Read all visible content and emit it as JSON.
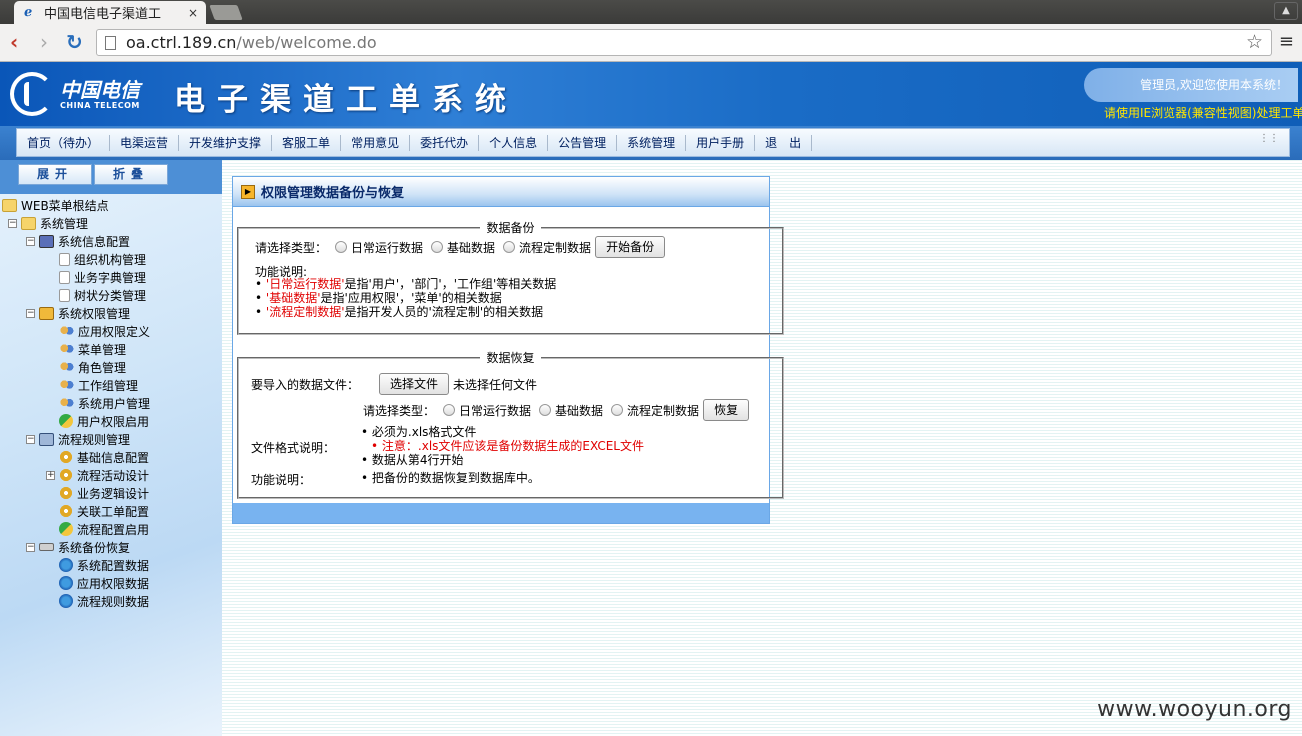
{
  "browser": {
    "tab_title": "中国电信电子渠道工",
    "tab_close": "×",
    "url_host": "oa.ctrl.189.cn",
    "url_path": "/web/welcome.do",
    "nav_back": "‹",
    "nav_forward": "›",
    "nav_reload": "↻",
    "star": "☆",
    "menu": "≡"
  },
  "header": {
    "logo_cn": "中国电信",
    "logo_en": "CHINA TELECOM",
    "system_title": "电子渠道工单系统",
    "welcome": "管理员,欢迎您使用本系统！",
    "ie_note": "请使用IE浏览器(兼容性视图)处理工单"
  },
  "nav": {
    "items": [
      "首页（待办）",
      "电渠运营",
      "开发维护支撑",
      "客服工单",
      "常用意见",
      "委托代办",
      "个人信息",
      "公告管理",
      "系统管理",
      "用户手册",
      "退　出"
    ]
  },
  "left": {
    "expand": "展开",
    "collapse": "折叠",
    "tree": [
      {
        "label": "WEB菜单根结点",
        "level": 0,
        "icon": "folder-icon",
        "toggle": ""
      },
      {
        "label": "系统管理",
        "level": 1,
        "icon": "folder-icon",
        "toggle": "−"
      },
      {
        "label": "系统信息配置",
        "level": 2,
        "icon": "book-icon",
        "toggle": "−"
      },
      {
        "label": "组织机构管理",
        "level": 3,
        "icon": "document-icon",
        "toggle": ""
      },
      {
        "label": "业务字典管理",
        "level": 3,
        "icon": "document-icon",
        "toggle": ""
      },
      {
        "label": "树状分类管理",
        "level": 3,
        "icon": "document-icon",
        "toggle": ""
      },
      {
        "label": "系统权限管理",
        "level": 2,
        "icon": "lock-icon",
        "toggle": "−"
      },
      {
        "label": "应用权限定义",
        "level": 3,
        "icon": "users-icon",
        "toggle": ""
      },
      {
        "label": "菜单管理",
        "level": 3,
        "icon": "users-icon",
        "toggle": ""
      },
      {
        "label": "角色管理",
        "level": 3,
        "icon": "users-icon",
        "toggle": ""
      },
      {
        "label": "工作组管理",
        "level": 3,
        "icon": "users-icon",
        "toggle": ""
      },
      {
        "label": "系统用户管理",
        "level": 3,
        "icon": "users-icon",
        "toggle": ""
      },
      {
        "label": "用户权限启用",
        "level": 3,
        "icon": "app-icon",
        "toggle": ""
      },
      {
        "label": "流程规则管理",
        "level": 2,
        "icon": "computer-icon",
        "toggle": "−"
      },
      {
        "label": "基础信息配置",
        "level": 3,
        "icon": "gear-icon",
        "toggle": ""
      },
      {
        "label": "流程活动设计",
        "level": 3,
        "icon": "gear-icon",
        "toggle": "+"
      },
      {
        "label": "业务逻辑设计",
        "level": 3,
        "icon": "gear-icon",
        "toggle": ""
      },
      {
        "label": "关联工单配置",
        "level": 3,
        "icon": "gear-icon",
        "toggle": ""
      },
      {
        "label": "流程配置启用",
        "level": 3,
        "icon": "app-icon",
        "toggle": ""
      },
      {
        "label": "系统备份恢复",
        "level": 2,
        "icon": "drive-icon",
        "toggle": "−"
      },
      {
        "label": "系统配置数据",
        "level": 3,
        "icon": "globe-icon",
        "toggle": ""
      },
      {
        "label": "应用权限数据",
        "level": 3,
        "icon": "globe-icon",
        "toggle": ""
      },
      {
        "label": "流程规则数据",
        "level": 3,
        "icon": "globe-icon",
        "toggle": ""
      }
    ]
  },
  "main": {
    "title": "权限管理数据备份与恢复",
    "backup": {
      "legend": "数据备份",
      "select_label": "请选择类型：",
      "options": [
        "日常运行数据",
        "基础数据",
        "流程定制数据"
      ],
      "start_button": "开始备份",
      "func_label": "功能说明:",
      "desc": [
        {
          "red": "'日常运行数据'",
          "rest": "是指'用户'，'部门'，'工作组'等相关数据"
        },
        {
          "red": "'基础数据'",
          "rest": "是指'应用权限'，'菜单'的相关数据"
        },
        {
          "red": "'流程定制数据'",
          "rest": "是指开发人员的'流程定制'的相关数据"
        }
      ]
    },
    "restore": {
      "legend": "数据恢复",
      "file_label": "要导入的数据文件：",
      "choose_button": "选择文件",
      "no_file": "未选择任何文件",
      "select_label": "请选择类型：",
      "options": [
        "日常运行数据",
        "基础数据",
        "流程定制数据"
      ],
      "restore_button": "恢复",
      "format_label": "文件格式说明：",
      "format_items": [
        "必须为.xls格式文件",
        "注意：.xls文件应该是备份数据生成的EXCEL文件",
        "数据从第4行开始"
      ],
      "func_label": "功能说明：",
      "func_items": [
        "把备份的数据恢复到数据库中。"
      ]
    }
  },
  "watermark": "www.wooyun.org"
}
